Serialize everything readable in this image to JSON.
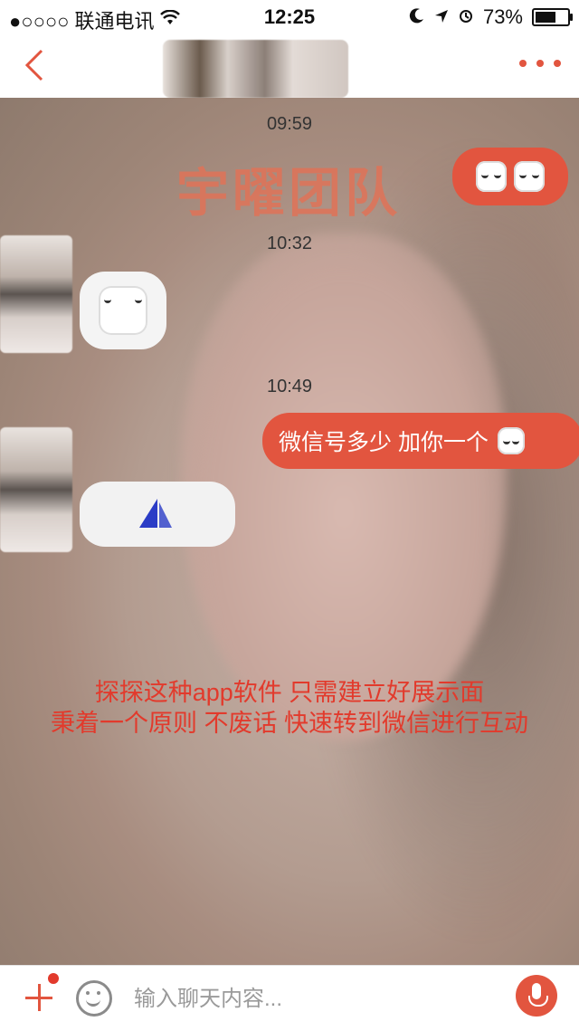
{
  "status": {
    "carrier": "●○○○○ 联通电讯",
    "time": "12:25",
    "battery_text": "73%",
    "battery_level": 0.73
  },
  "messages": {
    "t1": "09:59",
    "t2": "10:32",
    "t3": "10:49",
    "outgoing_text": "微信号多少 加你一个"
  },
  "watermark": "宇曜团队",
  "caption": {
    "line1": "探探这种app软件 只需建立好展示面",
    "line2": "秉着一个原则 不废话 快速转到微信进行互动"
  },
  "input": {
    "placeholder": "输入聊天内容..."
  },
  "icons": {
    "back": "chevron-left-icon",
    "more": "more-dots-icon",
    "add": "plus-icon",
    "emoji": "smile-icon",
    "mic": "microphone-icon"
  },
  "colors": {
    "accent": "#e2553f",
    "caption": "#e23a2c"
  }
}
